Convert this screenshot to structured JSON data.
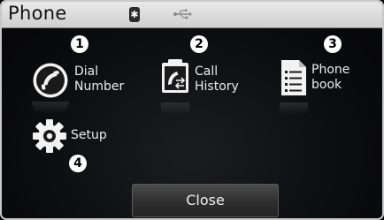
{
  "header": {
    "title": "Phone",
    "bluetooth_glyph": "✱",
    "status_icons": [
      "bluetooth-icon",
      "usb-icon"
    ]
  },
  "menu": {
    "items": [
      {
        "number": "1",
        "label_line1": "Dial",
        "label_line2": "Number",
        "icon": "phone-handset-icon"
      },
      {
        "number": "2",
        "label_line1": "Call",
        "label_line2": "History",
        "icon": "call-history-icon"
      },
      {
        "number": "3",
        "label_line1": "Phone",
        "label_line2": "book",
        "icon": "phonebook-icon"
      },
      {
        "number": "4",
        "label_line1": "Setup",
        "icon": "gear-icon"
      }
    ]
  },
  "footer": {
    "close_label": "Close"
  },
  "colors": {
    "title_bar": "#d9d9d9",
    "background": "#0e0f11",
    "text": "#ececec",
    "button": "#3a3a3a"
  }
}
